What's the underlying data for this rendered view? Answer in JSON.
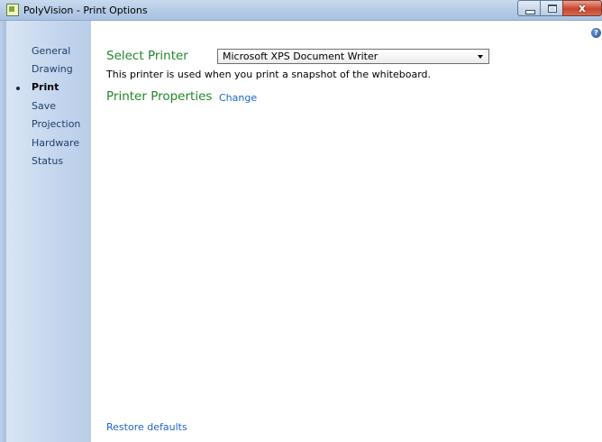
{
  "window": {
    "title": "PolyVision - Print Options",
    "controls": {
      "minimize": "minimize",
      "maximize": "maximize",
      "close": "x"
    }
  },
  "sidebar": {
    "items": [
      {
        "label": "General",
        "active": false
      },
      {
        "label": "Drawing",
        "active": false
      },
      {
        "label": "Print",
        "active": true
      },
      {
        "label": "Save",
        "active": false
      },
      {
        "label": "Projection",
        "active": false
      },
      {
        "label": "Hardware",
        "active": false
      },
      {
        "label": "Status",
        "active": false
      }
    ]
  },
  "main": {
    "select_printer_label": "Select Printer",
    "printer_select": {
      "value": "Microsoft XPS Document Writer"
    },
    "printer_description": "This printer is used when you print a snapshot of the whiteboard.",
    "printer_properties_label": "Printer Properties",
    "change_link": "Change",
    "restore_defaults_link": "Restore defaults"
  },
  "colors": {
    "accent_green": "#22862a",
    "link_blue": "#1a66cc",
    "sidebar_blue": "#c4d6ee"
  }
}
